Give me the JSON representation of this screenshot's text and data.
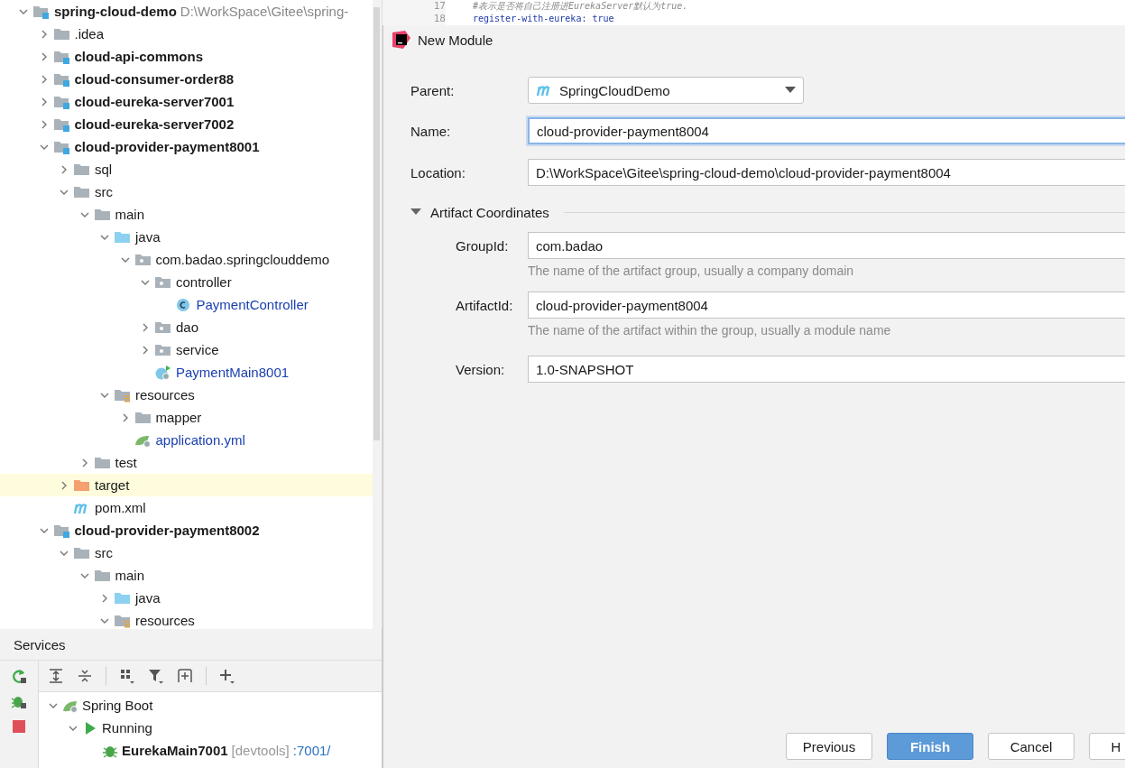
{
  "project_tree": {
    "nodes": [
      {
        "label": "spring-cloud-demo",
        "path": "D:\\WorkSpace\\Gitee\\spring-",
        "kind": "module",
        "bold": true,
        "expanded": true,
        "selected": false,
        "children": [
          {
            "label": ".idea",
            "kind": "folder",
            "expanded": false,
            "selected": false
          },
          {
            "label": "cloud-api-commons",
            "kind": "module",
            "bold": true,
            "expanded": false,
            "selected": false
          },
          {
            "label": "cloud-consumer-order88",
            "kind": "module",
            "bold": true,
            "expanded": false,
            "selected": false
          },
          {
            "label": "cloud-eureka-server7001",
            "kind": "module",
            "bold": true,
            "expanded": false,
            "selected": false
          },
          {
            "label": "cloud-eureka-server7002",
            "kind": "module",
            "bold": true,
            "expanded": false,
            "selected": false
          },
          {
            "label": "cloud-provider-payment8001",
            "kind": "module",
            "bold": true,
            "expanded": true,
            "selected": false,
            "children": [
              {
                "label": "sql",
                "kind": "folder",
                "expanded": false,
                "selected": false
              },
              {
                "label": "src",
                "kind": "folder",
                "expanded": true,
                "selected": false,
                "children": [
                  {
                    "label": "main",
                    "kind": "folder",
                    "expanded": true,
                    "selected": false,
                    "children": [
                      {
                        "label": "java",
                        "kind": "source",
                        "expanded": true,
                        "selected": false,
                        "children": [
                          {
                            "label": "com.badao.springclouddemo",
                            "kind": "package",
                            "expanded": true,
                            "selected": false,
                            "children": [
                              {
                                "label": "controller",
                                "kind": "package",
                                "expanded": true,
                                "selected": false,
                                "children": [
                                  {
                                    "label": "PaymentController",
                                    "kind": "class",
                                    "selected": false
                                  }
                                ]
                              },
                              {
                                "label": "dao",
                                "kind": "package",
                                "expanded": false,
                                "selected": false
                              },
                              {
                                "label": "service",
                                "kind": "package",
                                "expanded": false,
                                "selected": false
                              },
                              {
                                "label": "PaymentMain8001",
                                "kind": "main-class",
                                "selected": false
                              }
                            ]
                          }
                        ]
                      },
                      {
                        "label": "resources",
                        "kind": "resources",
                        "expanded": true,
                        "selected": false,
                        "children": [
                          {
                            "label": "mapper",
                            "kind": "folder",
                            "expanded": false,
                            "selected": false
                          },
                          {
                            "label": "application.yml",
                            "kind": "yaml",
                            "selected": false
                          }
                        ]
                      }
                    ]
                  },
                  {
                    "label": "test",
                    "kind": "folder",
                    "expanded": false,
                    "selected": false
                  }
                ]
              },
              {
                "label": "target",
                "kind": "excluded",
                "expanded": false,
                "selected": true
              },
              {
                "label": "pom.xml",
                "kind": "maven",
                "selected": false
              }
            ]
          },
          {
            "label": "cloud-provider-payment8002",
            "kind": "module",
            "bold": true,
            "expanded": true,
            "selected": false,
            "children": [
              {
                "label": "src",
                "kind": "folder",
                "expanded": true,
                "selected": false,
                "children": [
                  {
                    "label": "main",
                    "kind": "folder",
                    "expanded": true,
                    "selected": false,
                    "children": [
                      {
                        "label": "java",
                        "kind": "source",
                        "expanded": false,
                        "selected": false
                      },
                      {
                        "label": "resources",
                        "kind": "resources",
                        "expanded": true,
                        "selected": false
                      }
                    ]
                  }
                ]
              }
            ]
          }
        ]
      }
    ]
  },
  "editor": {
    "lines": [
      {
        "number": "17",
        "code": "#表示是否将自己注册进EurekaServer默认为true."
      },
      {
        "number": "18",
        "code": "register-with-eureka: true"
      }
    ]
  },
  "services": {
    "title": "Services",
    "nodes": [
      {
        "label": "Spring Boot",
        "kind": "spring",
        "expanded": true,
        "children": [
          {
            "label": "Running",
            "kind": "running",
            "expanded": true,
            "children": [
              {
                "label": "EurekaMain7001",
                "tag": "[devtools]",
                "port": ":7001/",
                "kind": "app"
              }
            ]
          }
        ]
      }
    ]
  },
  "dialog": {
    "title": "New Module",
    "fields": [
      {
        "label": "Parent:",
        "kind": "dropdown",
        "value": "SpringCloudDemo",
        "focused": false
      },
      {
        "label": "Name:",
        "kind": "text",
        "value": "cloud-provider-payment8004",
        "focused": true
      },
      {
        "label": "Location:",
        "kind": "text",
        "value": "D:\\WorkSpace\\Gitee\\spring-cloud-demo\\cloud-provider-payment8004",
        "focused": false
      }
    ],
    "section": {
      "title": "Artifact Coordinates",
      "expanded": true,
      "fields": [
        {
          "label": "GroupId:",
          "value": "com.badao",
          "hint": "The name of the artifact group, usually a company domain"
        },
        {
          "label": "ArtifactId:",
          "value": "cloud-provider-payment8004",
          "hint": "The name of the artifact within the group, usually a module name"
        },
        {
          "label": "Version:",
          "value": "1.0-SNAPSHOT"
        }
      ]
    },
    "buttons": [
      {
        "label": "Previous",
        "primary": false
      },
      {
        "label": "Finish",
        "primary": true
      },
      {
        "label": "Cancel",
        "primary": false
      },
      {
        "label": "H",
        "primary": false
      }
    ]
  }
}
